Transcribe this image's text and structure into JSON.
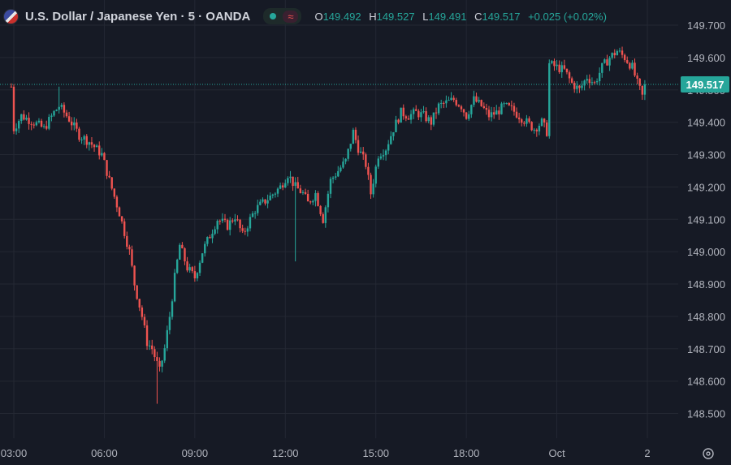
{
  "header": {
    "title": "U.S. Dollar / Japanese Yen · 5 · OANDA",
    "pill_icon": "≈",
    "ohlc": {
      "o_label": "O",
      "o": "149.492",
      "h_label": "H",
      "h": "149.527",
      "l_label": "L",
      "l": "149.491",
      "c_label": "C",
      "c": "149.517",
      "change": "+0.025 (+0.02%)"
    }
  },
  "colors": {
    "background": "#161a25",
    "up": "#26a69a",
    "down": "#ef5350",
    "grid": "#242833",
    "axis_text": "#b2b5be"
  },
  "icons": {
    "settings": "timezone-settings-icon",
    "flag": "usd-jpy-flag-icon"
  },
  "chart_data": {
    "type": "candlestick",
    "title": "U.S. Dollar / Japanese Yen · 5 · OANDA",
    "ylim": [
      148.45,
      149.75
    ],
    "y_ticks": [
      "149.700",
      "149.600",
      "149.500",
      "149.400",
      "149.300",
      "149.200",
      "149.100",
      "149.000",
      "148.900",
      "148.800",
      "148.700",
      "148.600",
      "148.500"
    ],
    "x_ticks": [
      {
        "label": "03:00",
        "t": 0
      },
      {
        "label": "06:00",
        "t": 36
      },
      {
        "label": "09:00",
        "t": 72
      },
      {
        "label": "12:00",
        "t": 108
      },
      {
        "label": "15:00",
        "t": 144
      },
      {
        "label": "18:00",
        "t": 180
      },
      {
        "label": "Oct",
        "t": 216
      },
      {
        "label": "2",
        "t": 252
      }
    ],
    "t_range": [
      -1,
      260
    ],
    "last_price": "149.517",
    "last_price_value": 149.517,
    "anchors": [
      [
        0,
        149.38
      ],
      [
        3,
        149.42
      ],
      [
        8,
        149.4
      ],
      [
        12,
        149.38
      ],
      [
        16,
        149.43
      ],
      [
        18,
        149.45
      ],
      [
        22,
        149.41
      ],
      [
        26,
        149.36
      ],
      [
        30,
        149.34
      ],
      [
        35,
        149.3
      ],
      [
        38,
        149.22
      ],
      [
        42,
        149.12
      ],
      [
        46,
        149.0
      ],
      [
        48,
        148.9
      ],
      [
        51,
        148.8
      ],
      [
        53,
        148.72
      ],
      [
        55,
        148.7
      ],
      [
        58,
        148.63
      ],
      [
        60,
        148.7
      ],
      [
        62,
        148.8
      ],
      [
        64,
        148.92
      ],
      [
        66,
        149.02
      ],
      [
        69,
        148.95
      ],
      [
        72,
        148.92
      ],
      [
        75,
        149.0
      ],
      [
        78,
        149.05
      ],
      [
        81,
        149.1
      ],
      [
        85,
        149.08
      ],
      [
        88,
        149.11
      ],
      [
        91,
        149.05
      ],
      [
        94,
        149.1
      ],
      [
        96,
        149.13
      ],
      [
        99,
        149.15
      ],
      [
        102,
        149.17
      ],
      [
        106,
        149.2
      ],
      [
        109,
        149.24
      ],
      [
        112,
        149.2
      ],
      [
        115,
        149.18
      ],
      [
        117,
        149.15
      ],
      [
        120,
        149.18
      ],
      [
        123,
        149.1
      ],
      [
        126,
        149.22
      ],
      [
        129,
        149.25
      ],
      [
        132,
        149.28
      ],
      [
        135,
        149.37
      ],
      [
        137,
        149.32
      ],
      [
        140,
        149.27
      ],
      [
        142,
        149.18
      ],
      [
        145,
        149.3
      ],
      [
        148,
        149.32
      ],
      [
        151,
        149.38
      ],
      [
        154,
        149.43
      ],
      [
        157,
        149.42
      ],
      [
        160,
        149.43
      ],
      [
        163,
        149.42
      ],
      [
        166,
        149.4
      ],
      [
        169,
        149.45
      ],
      [
        172,
        149.46
      ],
      [
        175,
        149.47
      ],
      [
        178,
        149.45
      ],
      [
        180,
        149.42
      ],
      [
        183,
        149.47
      ],
      [
        186,
        149.45
      ],
      [
        189,
        149.42
      ],
      [
        192,
        149.43
      ],
      [
        195,
        149.45
      ],
      [
        198,
        149.44
      ],
      [
        201,
        149.42
      ],
      [
        204,
        149.4
      ],
      [
        207,
        149.38
      ],
      [
        210,
        149.4
      ],
      [
        212,
        149.37
      ],
      [
        213,
        149.58
      ],
      [
        216,
        149.57
      ],
      [
        219,
        149.56
      ],
      [
        222,
        149.52
      ],
      [
        225,
        149.5
      ],
      [
        228,
        149.54
      ],
      [
        231,
        149.52
      ],
      [
        234,
        149.57
      ],
      [
        237,
        149.6
      ],
      [
        240,
        149.62
      ],
      [
        243,
        149.6
      ],
      [
        246,
        149.57
      ],
      [
        248,
        149.52
      ],
      [
        250,
        149.48
      ],
      [
        251,
        149.51
      ]
    ],
    "spikes": [
      {
        "t": 18,
        "high": 149.51
      },
      {
        "t": 112,
        "low": 148.97
      },
      {
        "t": 57,
        "low": 148.53
      }
    ]
  }
}
